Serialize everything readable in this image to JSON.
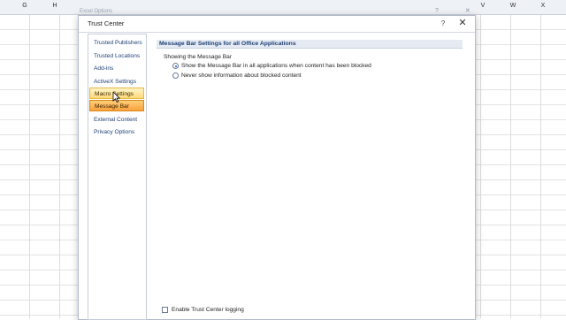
{
  "spreadsheet": {
    "columns": [
      "G",
      "H",
      "",
      "",
      "",
      "",
      "",
      "",
      "",
      "",
      "",
      "",
      "",
      "",
      "",
      "V",
      "W",
      "X"
    ],
    "ghost_title": "Excel Options"
  },
  "dialog": {
    "title": "Trust Center",
    "help": "?",
    "close": "✕"
  },
  "nav": {
    "items": [
      {
        "label": "Trusted Publishers"
      },
      {
        "label": "Trusted Locations"
      },
      {
        "label": "Add-ins"
      },
      {
        "label": "ActiveX Settings"
      },
      {
        "label": "Macro Settings"
      },
      {
        "label": "Message Bar"
      },
      {
        "label": "External Content"
      },
      {
        "label": "Privacy Options"
      }
    ],
    "hovered": "Macro Settings",
    "selected": "Message Bar"
  },
  "content": {
    "section_title": "Message Bar Settings for all Office Applications",
    "group_label": "Showing the Message Bar",
    "options": [
      {
        "label": "Show the Message Bar in all applications when content has been blocked",
        "checked": true
      },
      {
        "label": "Never show information about blocked content",
        "checked": false
      }
    ],
    "logging_label": "Enable Trust Center logging",
    "logging_checked": false
  },
  "colors": {
    "accent": "#1d3f76",
    "selected": "#f9a13b",
    "hover": "#ffd97a"
  }
}
